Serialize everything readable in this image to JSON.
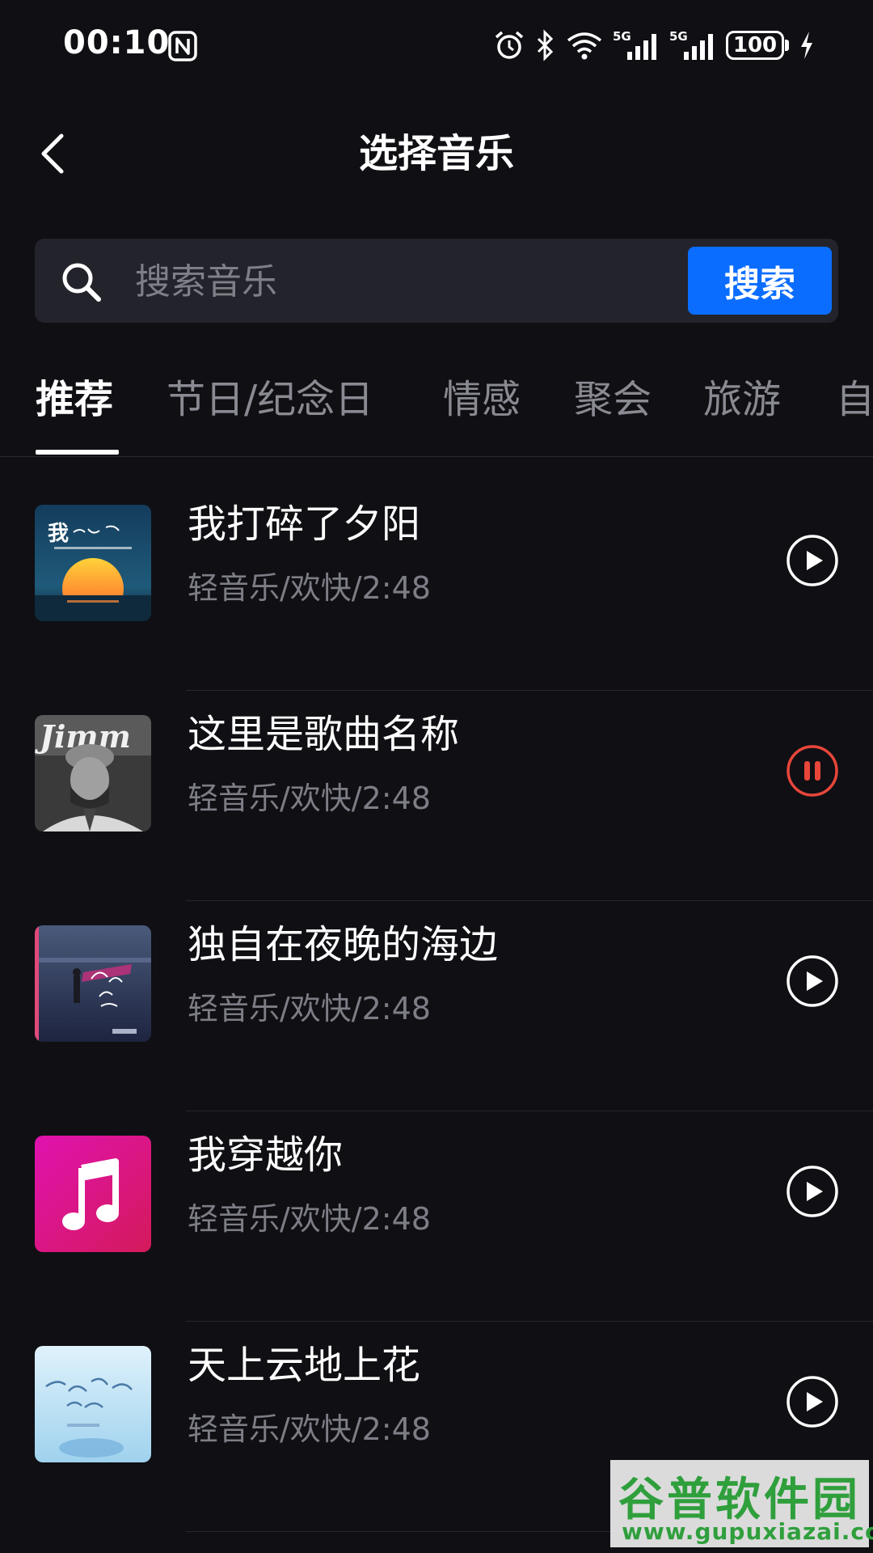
{
  "status_bar": {
    "time": "00:10",
    "network_1": "5G",
    "network_2": "5G",
    "battery": "100"
  },
  "header": {
    "title": "选择音乐"
  },
  "search": {
    "placeholder": "搜索音乐",
    "value": "",
    "button_label": "搜索"
  },
  "tabs": [
    {
      "label": "推荐",
      "active": true
    },
    {
      "label": "节日/纪念日",
      "active": false
    },
    {
      "label": "情感",
      "active": false
    },
    {
      "label": "聚会",
      "active": false
    },
    {
      "label": "旅游",
      "active": false
    },
    {
      "label": "自",
      "active": false
    }
  ],
  "songs": [
    {
      "title": "我打碎了夕阳",
      "meta": "轻音乐/欢快/2:48",
      "state": "play",
      "cover_icon": "sunset-cover"
    },
    {
      "title": "这里是歌曲名称",
      "meta": "轻音乐/欢快/2:48",
      "state": "pause",
      "cover_icon": "portrait-cover"
    },
    {
      "title": "独自在夜晚的海边",
      "meta": "轻音乐/欢快/2:48",
      "state": "play",
      "cover_icon": "seaside-cover"
    },
    {
      "title": "我穿越你",
      "meta": "轻音乐/欢快/2:48",
      "state": "play",
      "cover_icon": "music-note-cover"
    },
    {
      "title": "天上云地上花",
      "meta": "轻音乐/欢快/2:48",
      "state": "play",
      "cover_icon": "sky-cover"
    }
  ],
  "colors": {
    "background": "#0f0f14",
    "accent": "#0a6dff",
    "pause": "#e8463a"
  },
  "watermark": {
    "brand": "谷普软件园",
    "url": "www.gupuxiazai.com"
  }
}
